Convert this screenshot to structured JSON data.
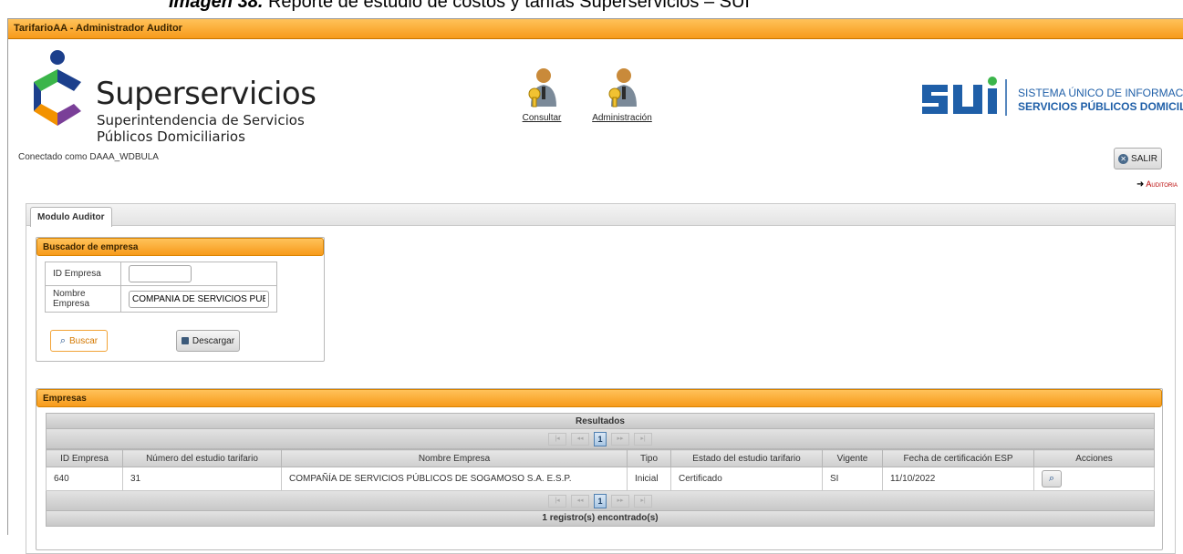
{
  "caption": {
    "bold": "Imagen 38.",
    "text": " Reporte de estudio de costos y tarifas Superservicios – SUI"
  },
  "window": {
    "title": "TarifarioAA - Administrador Auditor"
  },
  "header": {
    "brand": "Superservicios",
    "brand_sub1": "Superintendencia de Servicios",
    "brand_sub2": "Públicos Domiciliarios",
    "connected": "Conectado como DAAA_WDBULA",
    "nav": [
      {
        "label": "Consultar",
        "icon": "user-key-icon"
      },
      {
        "label": "Administración",
        "icon": "user-key-icon"
      }
    ],
    "sui_line1": "SISTEMA ÚNICO DE INFORMACIÓN DE",
    "sui_line2": "SERVICIOS PÚBLICOS DOMICILIARIOS",
    "logout_label": "SALIR",
    "audit_link": "Auditoria"
  },
  "tabs": [
    {
      "label": "Modulo Auditor"
    }
  ],
  "search": {
    "title": "Buscador de empresa",
    "id_label": "ID Empresa",
    "id_value": "",
    "name_label": "Nombre Empresa",
    "name_value": "COMPAÑIA DE SERVICIOS PUBLICOS",
    "search_button": "Buscar",
    "download_button": "Descargar"
  },
  "results": {
    "panel_title": "Empresas",
    "grid_title": "Resultados",
    "current_page": "1",
    "columns": [
      "ID Empresa",
      "Número del estudio tarifario",
      "Nombre Empresa",
      "Tipo",
      "Estado del estudio tarifario",
      "Vigente",
      "Fecha de certificación ESP",
      "Acciones"
    ],
    "rows": [
      {
        "id": "640",
        "estudio": "31",
        "nombre": "COMPAÑÍA DE SERVICIOS PÚBLICOS DE SOGAMOSO S.A. E.S.P.",
        "tipo": "Inicial",
        "estado": "Certificado",
        "vigente": "SI",
        "fecha": "11/10/2022"
      }
    ],
    "footer": "1 registro(s) encontrado(s)"
  },
  "colors": {
    "orange_header": "#f79a1a",
    "sui_blue": "#1f5fa8",
    "logo_blue": "#1c3f8c",
    "logo_green": "#3bb54a",
    "logo_orange": "#f39200",
    "logo_purple": "#7a3f98"
  }
}
